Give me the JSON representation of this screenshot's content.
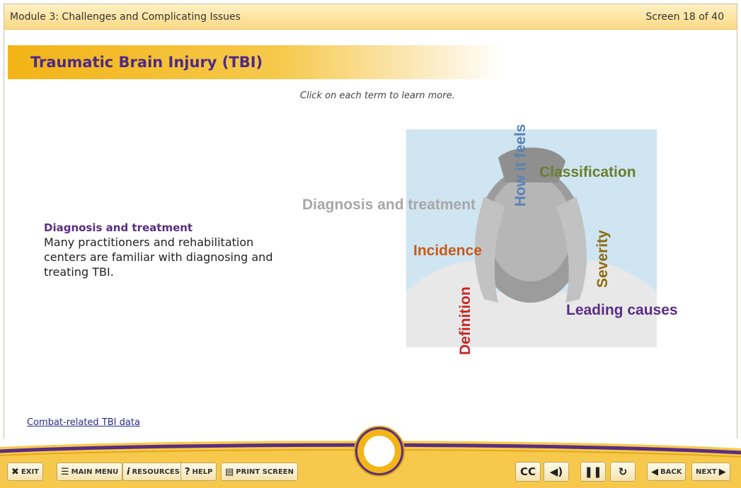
{
  "header": {
    "module_title": "Module 3: Challenges and Complicating Issues",
    "screen_count": "Screen 18 of 40"
  },
  "page": {
    "title": "Traumatic Brain Injury (TBI)",
    "instruction": "Click on each term to learn more."
  },
  "selected_term": {
    "heading": "Diagnosis and treatment",
    "description": "Many practitioners and rehabilitation centers are familiar with diagnosing and treating TBI."
  },
  "terms": {
    "diagnosis": "Diagnosis and treatment",
    "classification": "Classification",
    "incidence": "Incidence",
    "leading_causes": "Leading causes",
    "how_it_feels": "How it feels",
    "severity": "Severity",
    "definition": "Definition"
  },
  "links": {
    "combat": "Combat-related TBI data"
  },
  "toolbar": {
    "exit": "EXIT",
    "main_menu": "MAIN MENU",
    "resources": "RESOURCES",
    "help": "HELP",
    "print_screen": "PRINT SCREEN",
    "cc": "CC",
    "back": "BACK",
    "next": "NEXT"
  },
  "icons": {
    "exit": "close-icon",
    "menu": "menu-icon",
    "resources": "info-icon",
    "help": "help-icon",
    "print": "printer-icon",
    "audio": "volume-icon",
    "pause": "pause-icon",
    "replay": "replay-icon",
    "back": "back-arrow-icon",
    "next": "next-arrow-icon"
  },
  "colors": {
    "brand_purple": "#5a2d82",
    "brand_gold": "#f2b416"
  }
}
